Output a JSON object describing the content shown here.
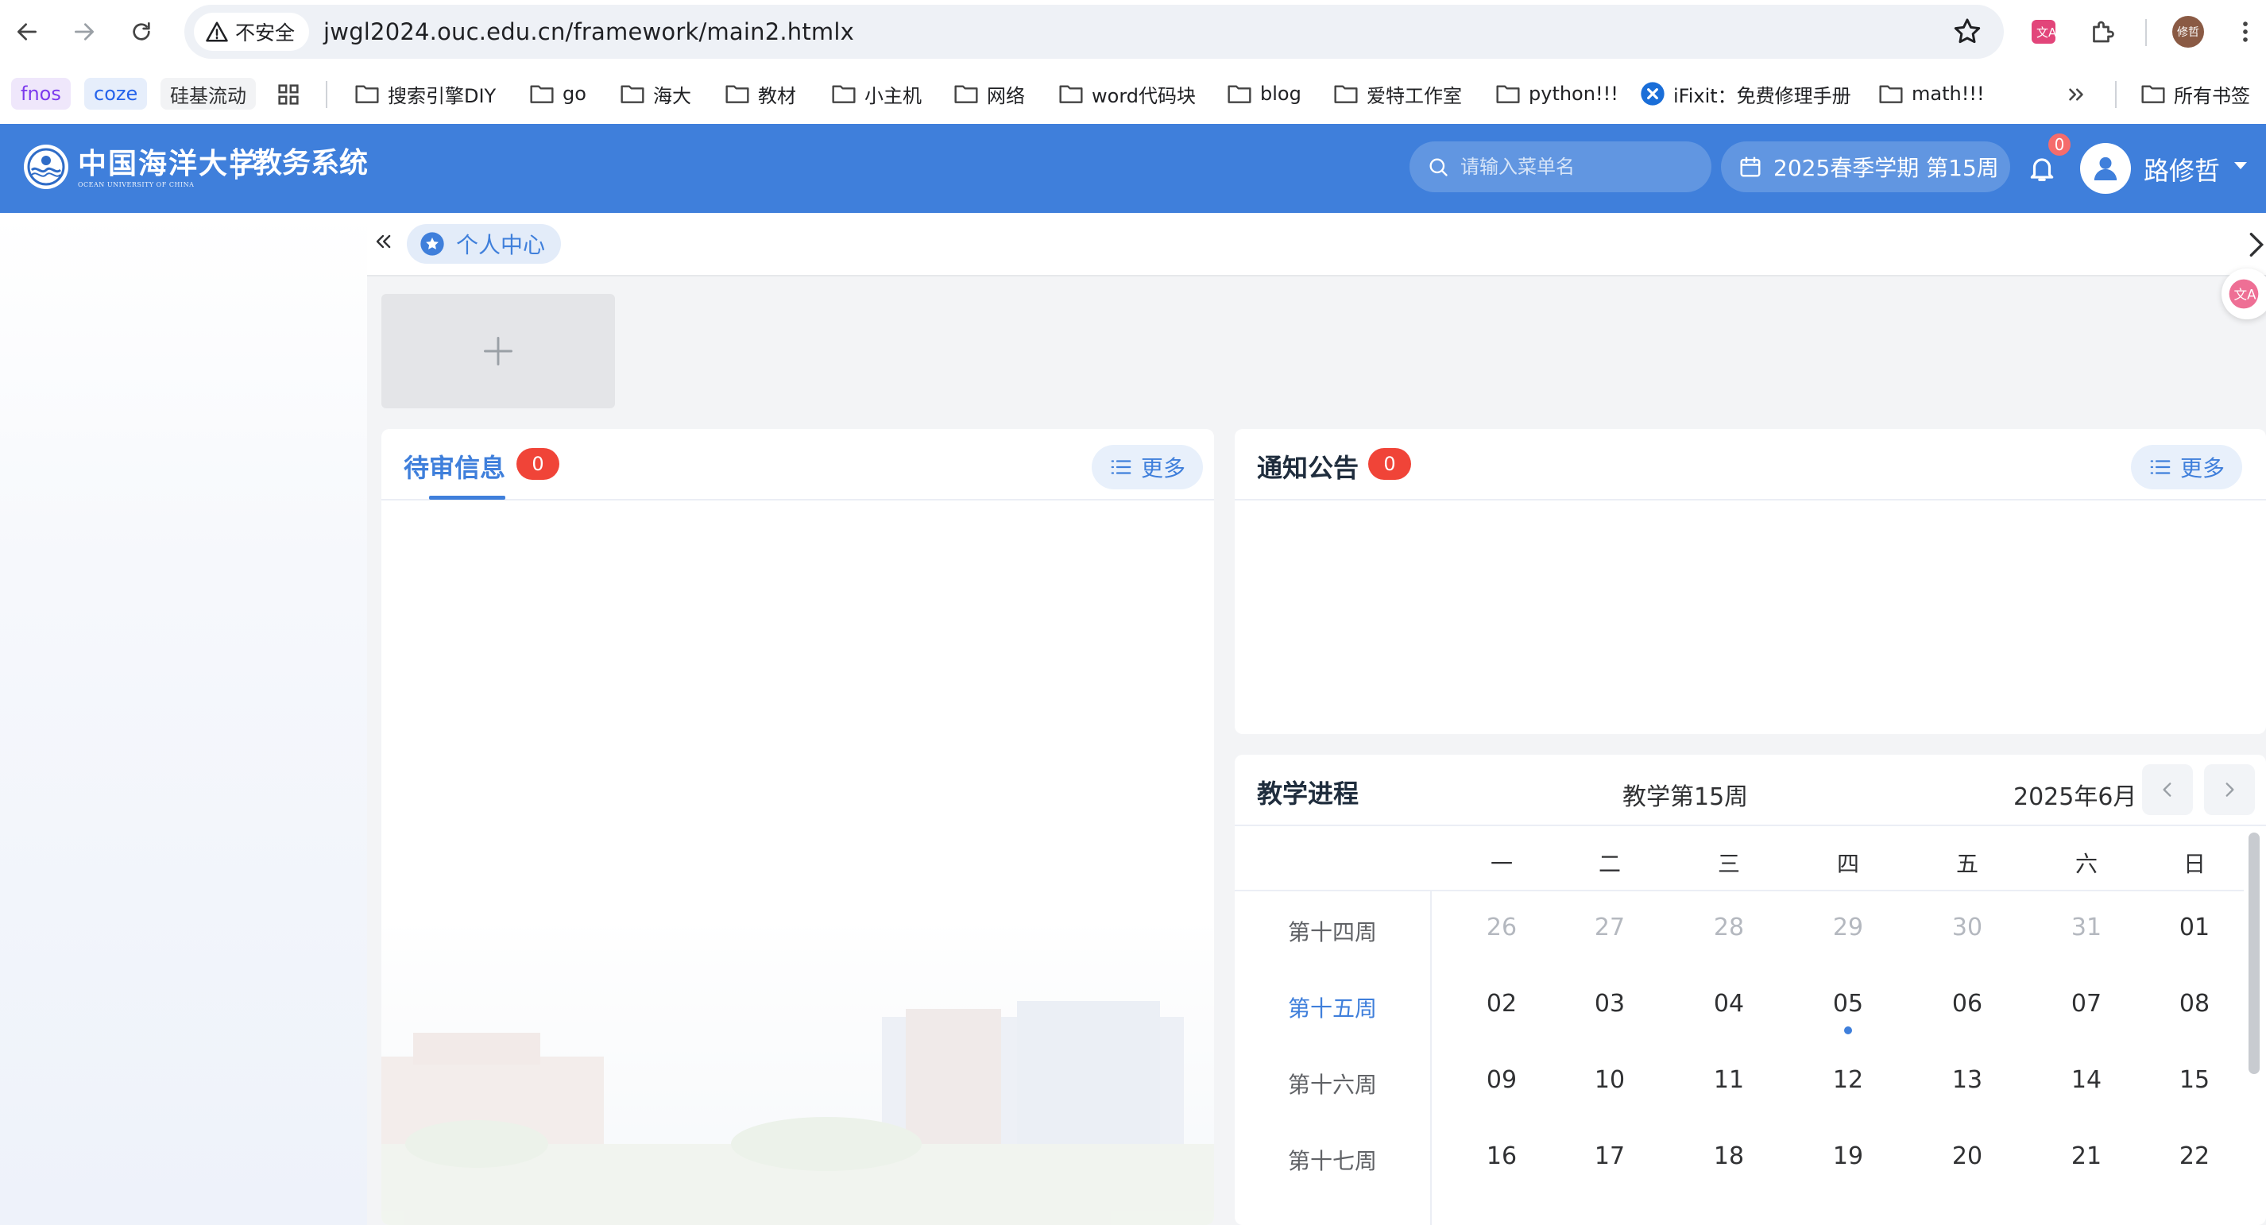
{
  "browser": {
    "security_label": "不安全",
    "url": "jwgl2024.ouc.edu.cn/framework/main2.htmlx",
    "profile_initials": "修哲"
  },
  "bookmarks": {
    "chips": [
      {
        "label": "fnos",
        "color": "#7c3aed",
        "bg": "#efe7fb"
      },
      {
        "label": "coze",
        "color": "#2563eb",
        "bg": "#e6eefb"
      },
      {
        "label": "硅基流动",
        "color": "#303133",
        "bg": "#f2f3f5"
      }
    ],
    "folders": [
      "搜索引擎DIY",
      "go",
      "海大",
      "教材",
      "小主机",
      "网络",
      "word代码块",
      "blog",
      "爱特工作室",
      "python!!!"
    ],
    "ifixit": "iFixit：免费修理手册",
    "math": "math!!!",
    "all_bookmarks": "所有书签"
  },
  "header": {
    "logo_cn": "中国海洋大学",
    "logo_en": "OCEAN UNIVERSITY OF CHINA",
    "system_name": "教务系统",
    "search_placeholder": "请输入菜单名",
    "term": "2025春季学期 第15周",
    "notification_count": "0",
    "user_name": "路修哲",
    "brand_color": "#3f7fdb"
  },
  "tabs": {
    "active": "个人中心"
  },
  "pending": {
    "title": "待审信息",
    "count": "0",
    "more": "更多"
  },
  "notice": {
    "title": "通知公告",
    "count": "0",
    "more": "更多"
  },
  "progress": {
    "title": "教学进程",
    "week_title": "教学第15周",
    "month": "2025年6月",
    "weekdays": [
      "一",
      "二",
      "三",
      "四",
      "五",
      "六",
      "日"
    ],
    "weeks": [
      {
        "label": "第十四周",
        "days": [
          "26",
          "27",
          "28",
          "29",
          "30",
          "31",
          "01"
        ],
        "current": false
      },
      {
        "label": "第十五周",
        "days": [
          "02",
          "03",
          "04",
          "05",
          "06",
          "07",
          "08"
        ],
        "current": true
      },
      {
        "label": "第十六周",
        "days": [
          "09",
          "10",
          "11",
          "12",
          "13",
          "14",
          "15"
        ],
        "current": false
      },
      {
        "label": "第十七周",
        "days": [
          "16",
          "17",
          "18",
          "19",
          "20",
          "21",
          "22"
        ],
        "current": false
      }
    ],
    "today": "05"
  }
}
